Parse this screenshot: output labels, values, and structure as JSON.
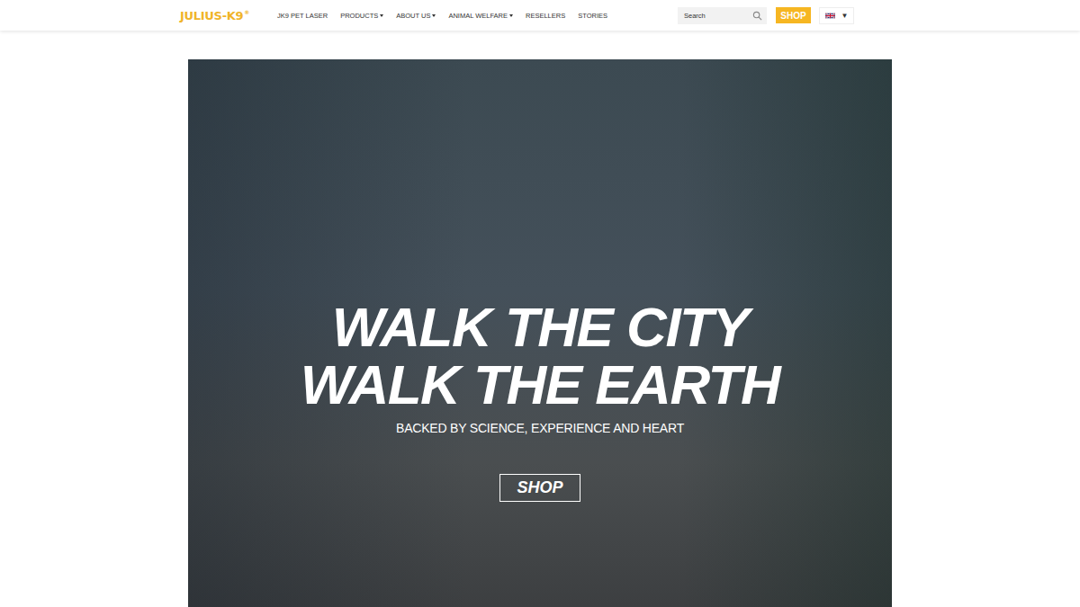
{
  "header": {
    "logo": "JULIUS-K9",
    "logo_mark": "®",
    "nav": [
      {
        "label": "JK9 PET LASER",
        "dropdown": false
      },
      {
        "label": "PRODUCTS",
        "dropdown": true
      },
      {
        "label": "ABOUT US",
        "dropdown": true
      },
      {
        "label": "ANIMAL WELFARE",
        "dropdown": true
      },
      {
        "label": "RESELLERS",
        "dropdown": false
      },
      {
        "label": "STORIES",
        "dropdown": false
      }
    ],
    "search": {
      "placeholder": "Search"
    },
    "shop_button": "SHOP",
    "language": {
      "caret": "▼"
    }
  },
  "hero": {
    "title_lines": [
      "WALK THE CITY",
      "WALK THE EARTH"
    ],
    "subtitle": "BACKED BY SCIENCE, EXPERIENCE AND HEART",
    "button": "SHOP"
  }
}
